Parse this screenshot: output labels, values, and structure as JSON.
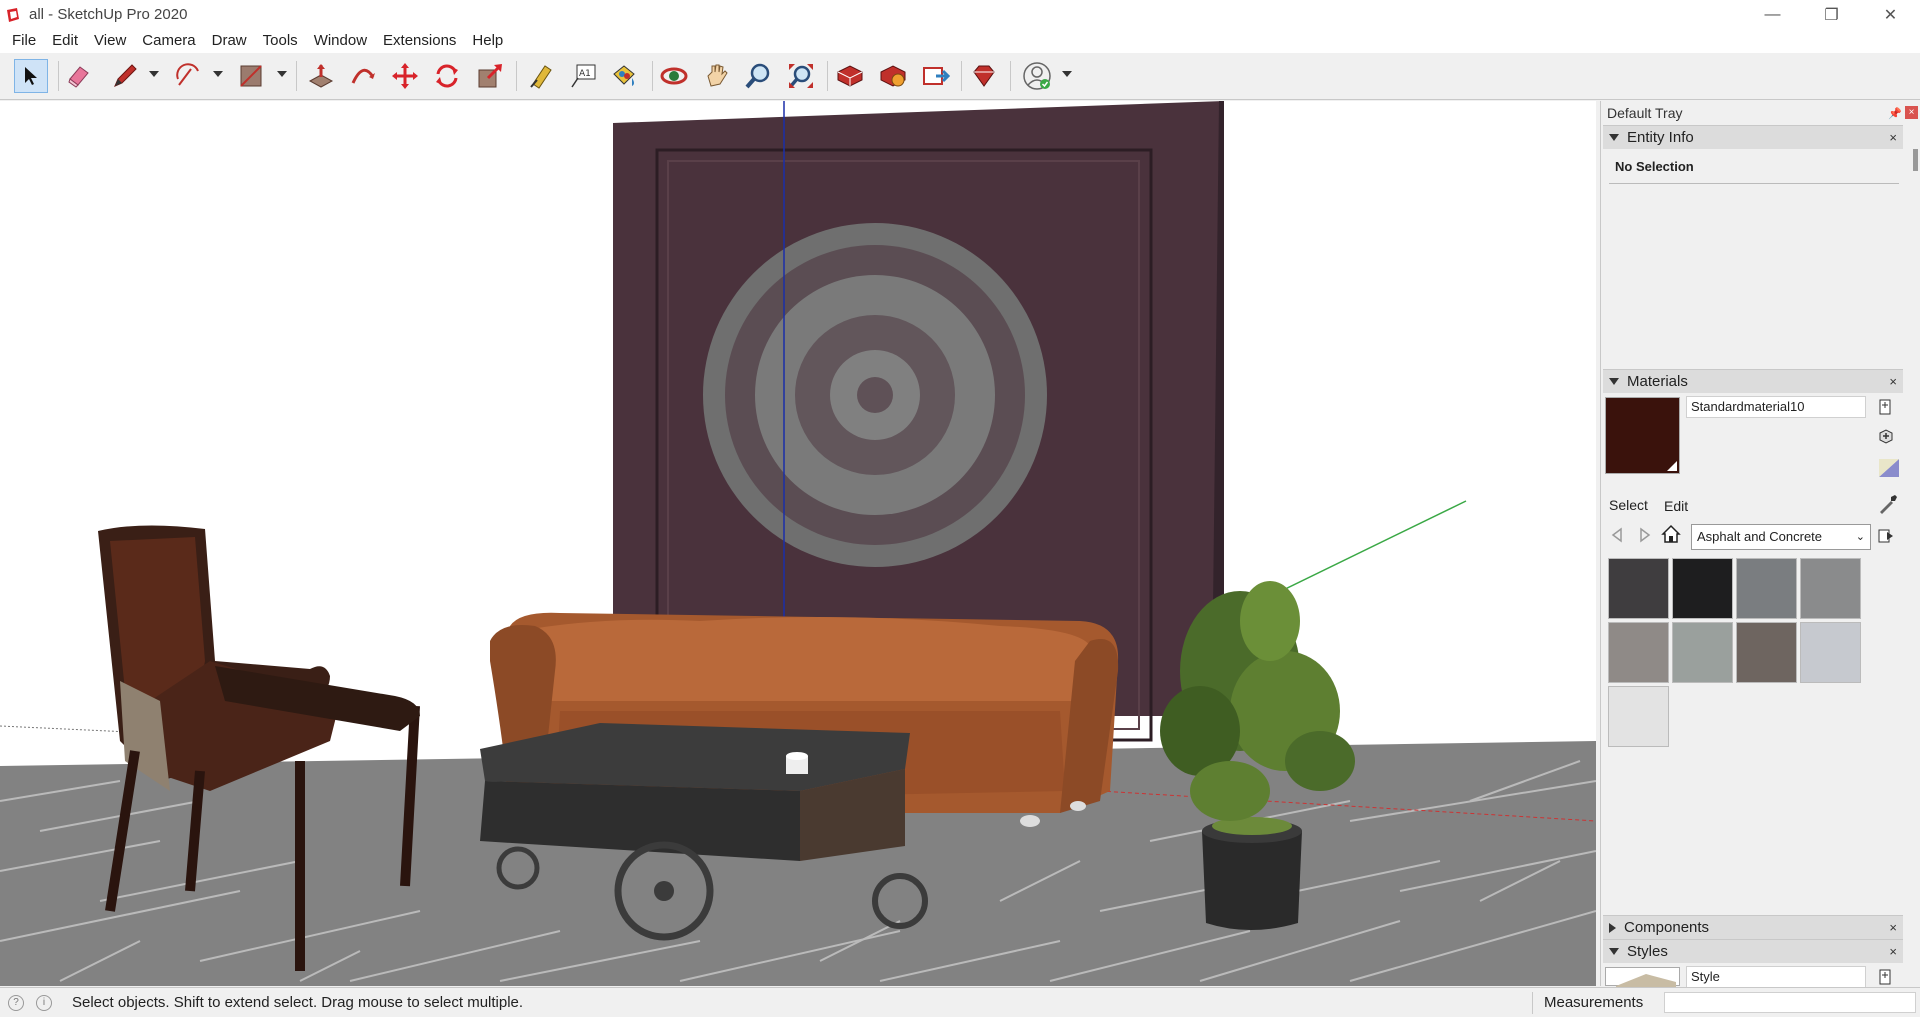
{
  "window": {
    "title": "all - SketchUp Pro 2020",
    "minimize_glyph": "—",
    "restore_glyph": "❐",
    "close_glyph": "✕"
  },
  "menu": [
    "File",
    "Edit",
    "View",
    "Camera",
    "Draw",
    "Tools",
    "Window",
    "Extensions",
    "Help"
  ],
  "toolbar": {
    "tools": [
      "select",
      "eraser",
      "pencil",
      "arc",
      "rectangle",
      "push-pull",
      "follow-me",
      "move",
      "rotate",
      "scale",
      "tape-measure",
      "text",
      "paint-bucket",
      "orbit",
      "pan",
      "zoom",
      "zoom-extents",
      "3d-warehouse",
      "extension-warehouse",
      "layout",
      "ruby",
      "account"
    ],
    "active_tool": "select"
  },
  "tray": {
    "title": "Default Tray",
    "pin_glyph": "📌",
    "close_glyph": "×",
    "entity_info": {
      "label": "Entity Info",
      "selection": "No Selection"
    },
    "materials": {
      "label": "Materials",
      "current_name": "Standardmaterial10",
      "current_color": "#3a120c",
      "tab_select": "Select",
      "tab_edit": "Edit",
      "collection": "Asphalt and Concrete",
      "swatch_colors": [
        "#3f3d3f",
        "#1e1e1f",
        "#7a7d80",
        "#8a8b8c",
        "#8f8a87",
        "#9aa09d",
        "#6e6560",
        "#c6c9cf",
        "#e3e3e3"
      ]
    },
    "components": {
      "label": "Components"
    },
    "styles": {
      "label": "Styles",
      "name": "Style"
    }
  },
  "statusbar": {
    "message": "Select objects. Shift to extend select. Drag mouse to select multiple.",
    "measurements_label": "Measurements",
    "measurements_value": ""
  }
}
